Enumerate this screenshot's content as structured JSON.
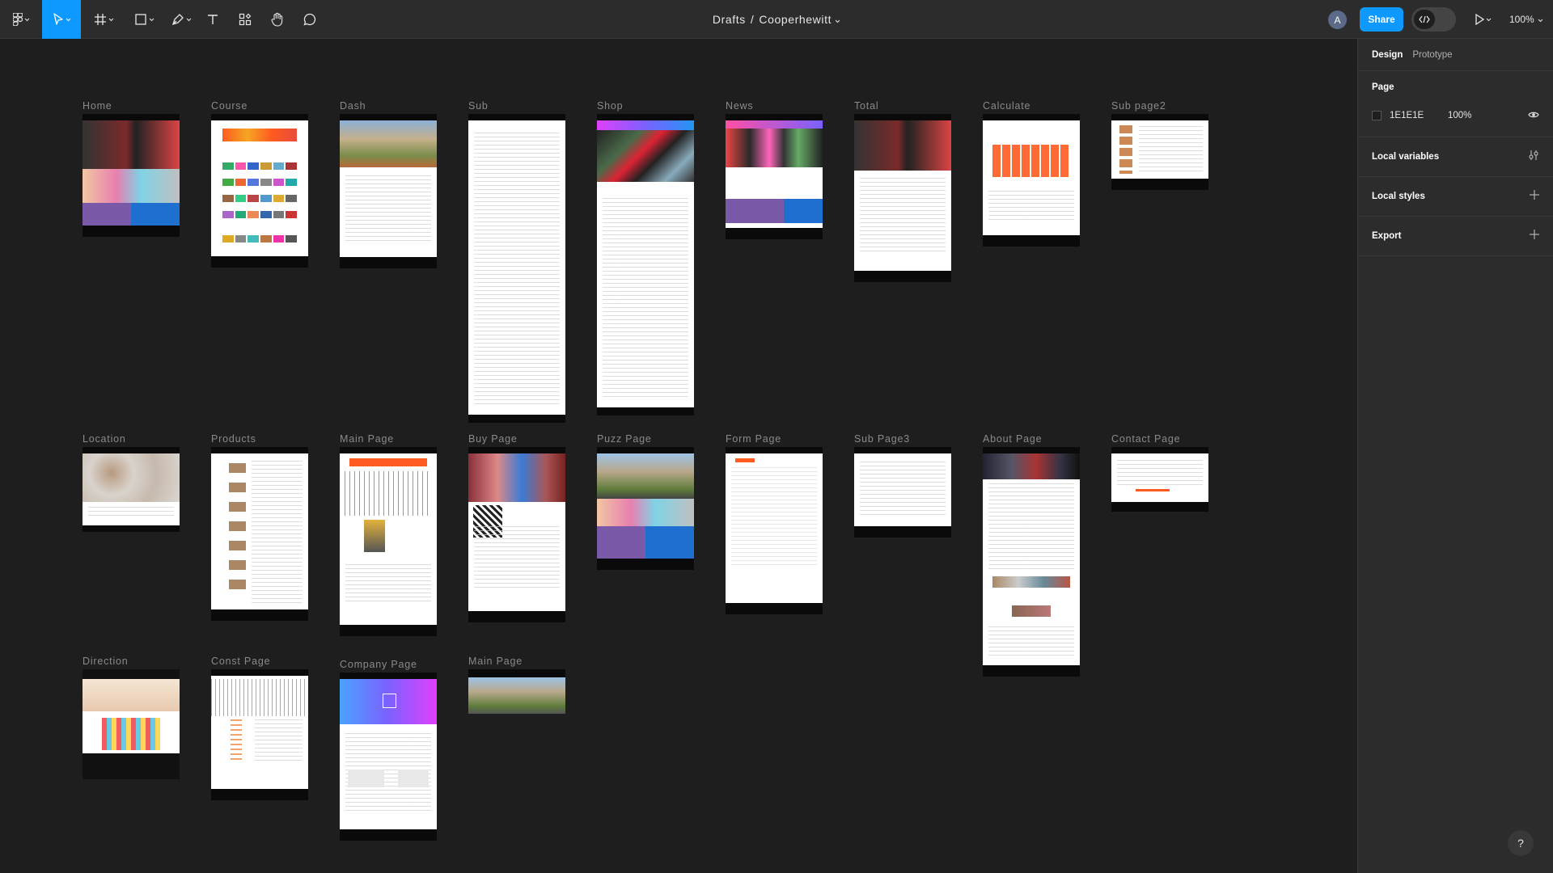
{
  "toolbar": {
    "breadcrumb_folder": "Drafts",
    "breadcrumb_separator": "/",
    "file_name": "Cooperhewitt",
    "avatar_initial": "A",
    "share_label": "Share",
    "zoom_label": "100%",
    "tools": [
      "main-menu",
      "move",
      "frame",
      "shape",
      "pen",
      "text",
      "resources",
      "hand",
      "comment"
    ],
    "accent_color": "#0d99ff"
  },
  "right_panel": {
    "tabs": [
      {
        "label": "Design",
        "active": true
      },
      {
        "label": "Prototype",
        "active": false
      }
    ],
    "page": {
      "title": "Page",
      "fill_hex": "1E1E1E",
      "opacity": "100%"
    },
    "sections": [
      {
        "title": "Local variables",
        "icon": "variables-settings-icon"
      },
      {
        "title": "Local styles",
        "icon": "plus-icon"
      },
      {
        "title": "Export",
        "icon": "plus-icon"
      }
    ]
  },
  "canvas": {
    "background": "#1e1e1e",
    "frames": [
      {
        "label": "Home",
        "style": "hero-colorful"
      },
      {
        "label": "Course",
        "style": "grid-orange"
      },
      {
        "label": "Dash",
        "style": "building-text"
      },
      {
        "label": "Sub",
        "style": "long-text"
      },
      {
        "label": "Shop",
        "style": "shop-gradient"
      },
      {
        "label": "News",
        "style": "news-purple"
      },
      {
        "label": "Total",
        "style": "hero-text"
      },
      {
        "label": "Calculate",
        "style": "calendar-orange"
      },
      {
        "label": "Sub page2",
        "style": "short-list"
      },
      {
        "label": "Location",
        "style": "map"
      },
      {
        "label": "Products",
        "style": "product-list"
      },
      {
        "label": "Main Page",
        "style": "building-sketch"
      },
      {
        "label": "Buy Page",
        "style": "buy-hero"
      },
      {
        "label": "Puzz Page",
        "style": "building-colorful"
      },
      {
        "label": "Form Page",
        "style": "form"
      },
      {
        "label": "Sub Page3",
        "style": "short-text"
      },
      {
        "label": "About Page",
        "style": "about"
      },
      {
        "label": "Contact Page",
        "style": "contact"
      },
      {
        "label": "Direction",
        "style": "direction"
      },
      {
        "label": "Const Page",
        "style": "sketch-text"
      },
      {
        "label": "Company Page",
        "style": "company-gradient"
      },
      {
        "label": "Main Page",
        "style": "building-only"
      }
    ]
  },
  "help": {
    "label": "?"
  }
}
